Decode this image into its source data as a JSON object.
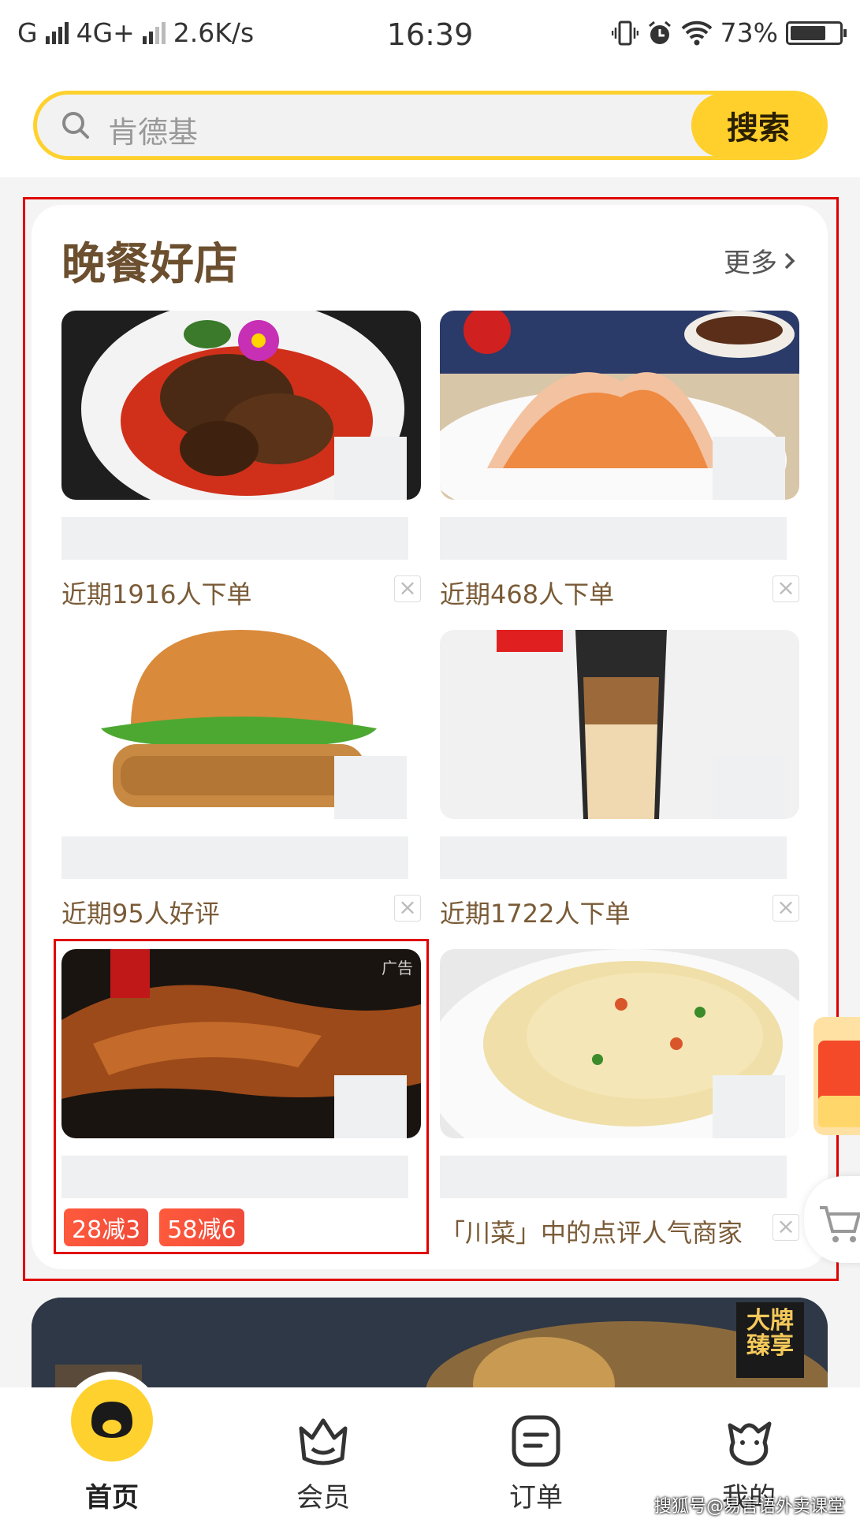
{
  "status_bar": {
    "carrier": "G",
    "network": "4G+",
    "speed": "2.6K/s",
    "time": "16:39",
    "battery": "73%",
    "battery_level": 0.73
  },
  "search": {
    "placeholder": "肯德基",
    "button_label": "搜索"
  },
  "section": {
    "title": "晚餐好店",
    "more_label": "更多"
  },
  "shops": [
    {
      "meta": "近期1916人下单"
    },
    {
      "meta": "近期468人下单"
    },
    {
      "meta": "近期95人好评"
    },
    {
      "meta": "近期1722人下单"
    },
    {
      "ad_label": "广告",
      "tags": [
        "28减3",
        "58减6"
      ]
    },
    {
      "meta": "「川菜」中的点评人气商家"
    }
  ],
  "banner": {
    "badge": "大牌臻享"
  },
  "tab_bar": {
    "items": [
      {
        "label": "首页",
        "icon": "home-face-icon",
        "active": true
      },
      {
        "label": "会员",
        "icon": "crown-basket-icon"
      },
      {
        "label": "订单",
        "icon": "order-list-icon"
      },
      {
        "label": "我的",
        "icon": "profile-icon"
      }
    ]
  },
  "watermark": "搜狐号@易言语外卖课堂",
  "colors": {
    "brand_yellow": "#ffd12e",
    "title_brown": "#6b4f2e",
    "tag_red": "#f04a3a",
    "outline_red": "#e00000"
  }
}
